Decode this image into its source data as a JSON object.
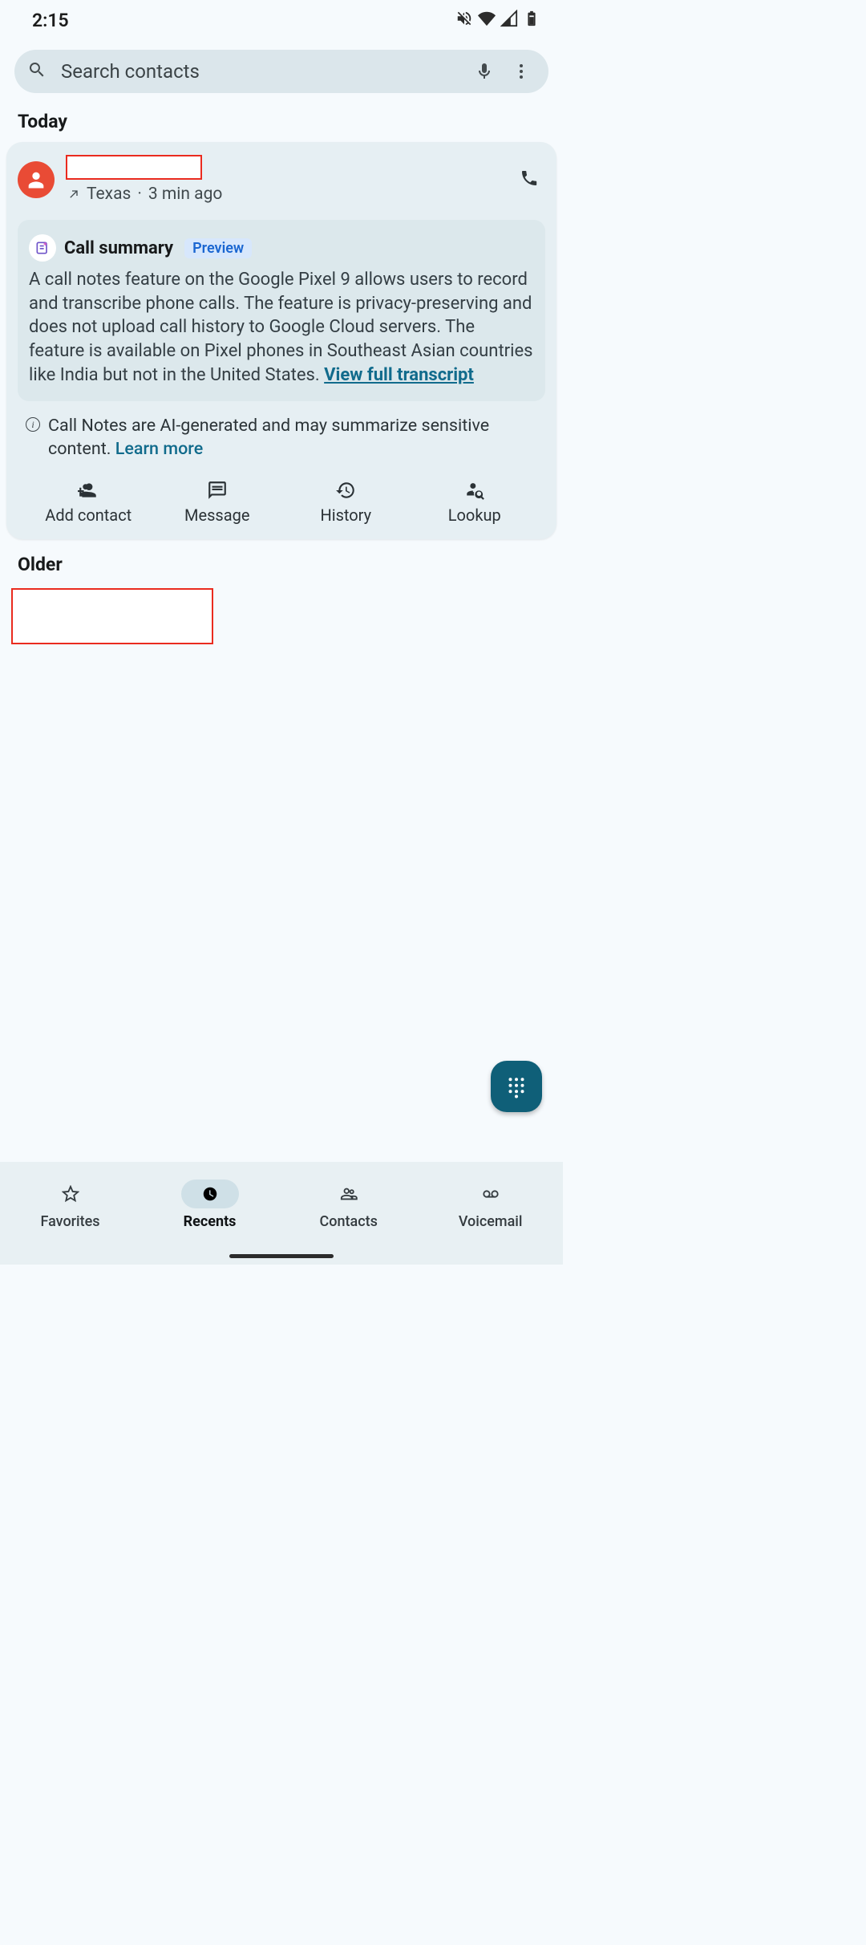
{
  "status": {
    "time": "2:15"
  },
  "search": {
    "placeholder": "Search contacts"
  },
  "sections": {
    "today": "Today",
    "older": "Older"
  },
  "call": {
    "name": "",
    "location": "Texas",
    "separator": "·",
    "age": "3 min ago"
  },
  "summary": {
    "title": "Call summary",
    "badge": "Preview",
    "body": "A call notes feature on the Google Pixel 9 allows users to record and transcribe phone calls. The feature is privacy-preserving and does not upload call history to Google Cloud servers. The feature is available on Pixel phones in Southeast Asian countries like India but not in the United States. ",
    "link": "View full transcript"
  },
  "ai_note": {
    "text": "Call Notes are AI-generated and may summarize sensitive content. ",
    "link": "Learn more"
  },
  "actions": {
    "add_contact": "Add contact",
    "message": "Message",
    "history": "History",
    "lookup": "Lookup"
  },
  "nav": {
    "favorites": "Favorites",
    "recents": "Recents",
    "contacts": "Contacts",
    "voicemail": "Voicemail"
  }
}
